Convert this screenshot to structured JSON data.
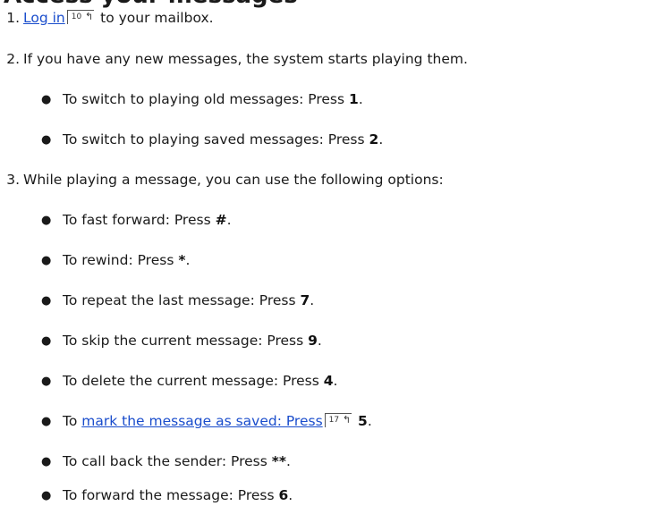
{
  "heading": "Access your messages",
  "steps": [
    {
      "number": "1.",
      "link_text": "Log in",
      "link_ref": "10",
      "after_link": "to your mailbox."
    },
    {
      "number": "2.",
      "text": "If you have any new messages, the system starts playing them.",
      "bullets": [
        {
          "text": "To switch to playing old messages: Press ",
          "key": "1",
          "end": "."
        },
        {
          "text": "To switch to playing saved messages: Press ",
          "key": "2",
          "end": "."
        }
      ]
    },
    {
      "number": "3.",
      "text": "While playing a message, you can use the following options:",
      "bullets": [
        {
          "text": "To fast forward: Press ",
          "key": "#",
          "end": "."
        },
        {
          "text": "To rewind: Press ",
          "key": "*",
          "end": "."
        },
        {
          "text": "To repeat the last message: Press ",
          "key": "7",
          "end": "."
        },
        {
          "text": "To skip the current message: Press ",
          "key": "9",
          "end": "."
        },
        {
          "text": "To delete the current message: Press ",
          "key": "4",
          "end": "."
        },
        {
          "prefix": "To ",
          "link_text": "mark the message as saved: Press",
          "link_ref": "17",
          "key": "5",
          "end": "."
        },
        {
          "text": "To call back the sender: Press ",
          "key": "**",
          "end": "."
        },
        {
          "text": "To forward the message: Press ",
          "key": "6",
          "end": "."
        }
      ]
    }
  ],
  "bullet_glyph": "●",
  "xref_arrow": "↰"
}
